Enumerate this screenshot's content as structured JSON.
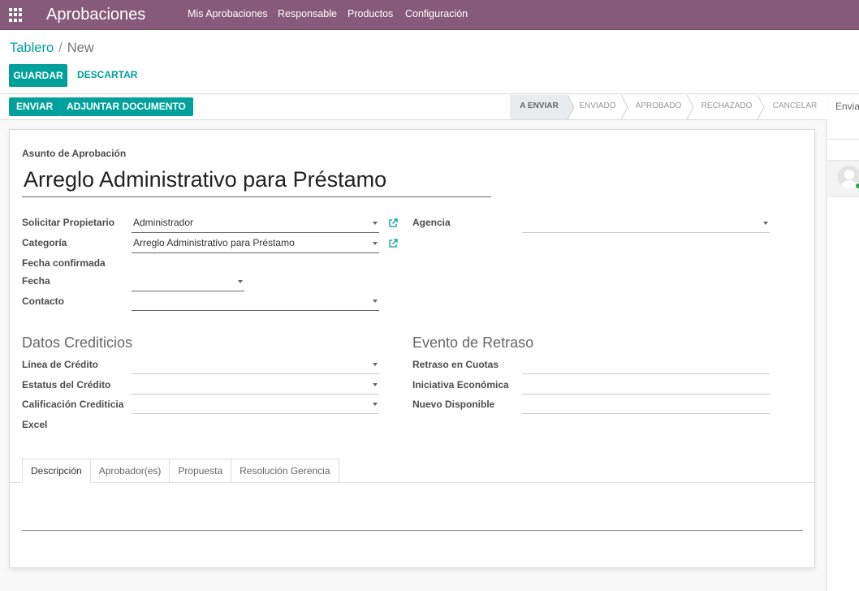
{
  "navbar": {
    "app_title": "Aprobaciones",
    "menu": [
      {
        "label": "Mis Aprobaciones"
      },
      {
        "label": "Responsable"
      },
      {
        "label": "Productos"
      },
      {
        "label": "Configuración"
      }
    ]
  },
  "breadcrumb": {
    "parent": "Tablero",
    "separator": "/",
    "current": "New"
  },
  "actions": {
    "save": "GUARDAR",
    "discard": "DESCARTAR"
  },
  "statusbar": {
    "buttons": [
      "ENVIAR",
      "ADJUNTAR DOCUMENTO"
    ],
    "stages": [
      {
        "label": "A ENVIAR",
        "active": true
      },
      {
        "label": "ENVIADO",
        "active": false
      },
      {
        "label": "APROBADO",
        "active": false
      },
      {
        "label": "RECHAZADO",
        "active": false
      },
      {
        "label": "CANCELAR",
        "active": false
      }
    ]
  },
  "form": {
    "subject_label": "Asunto de Aprobación",
    "subject_value": "Arreglo Administrativo para Préstamo",
    "fields": {
      "owner": {
        "label": "Solicitar Propietario",
        "value": "Administrador"
      },
      "category": {
        "label": "Categoría",
        "value": "Arreglo Administrativo para Préstamo"
      },
      "confirmed_date": {
        "label": "Fecha confirmada"
      },
      "date": {
        "label": "Fecha",
        "value": ""
      },
      "contact": {
        "label": "Contacto",
        "value": ""
      },
      "agency": {
        "label": "Agencia",
        "value": ""
      }
    },
    "credit_section": {
      "title": "Datos Crediticios",
      "fields": [
        {
          "label": "Línea de Crédito",
          "value": ""
        },
        {
          "label": "Estatus del Crédito",
          "value": ""
        },
        {
          "label": "Calificación Crediticia",
          "value": ""
        },
        {
          "label": "Excel",
          "value": ""
        }
      ]
    },
    "delay_section": {
      "title": "Evento de Retraso",
      "fields": [
        {
          "label": "Retraso en Cuotas",
          "value": ""
        },
        {
          "label": "Iniciativa Económica",
          "value": ""
        },
        {
          "label": "Nuevo Disponible",
          "value": ""
        }
      ]
    },
    "tabs": [
      {
        "label": "Descripción",
        "active": true
      },
      {
        "label": "Aprobador(es)",
        "active": false
      },
      {
        "label": "Propuesta",
        "active": false
      },
      {
        "label": "Resolución Gerencia",
        "active": false
      }
    ]
  },
  "chatter": {
    "send_label": "Enviar"
  },
  "colors": {
    "navbar": "#875a7b",
    "primary": "#00a09d"
  }
}
